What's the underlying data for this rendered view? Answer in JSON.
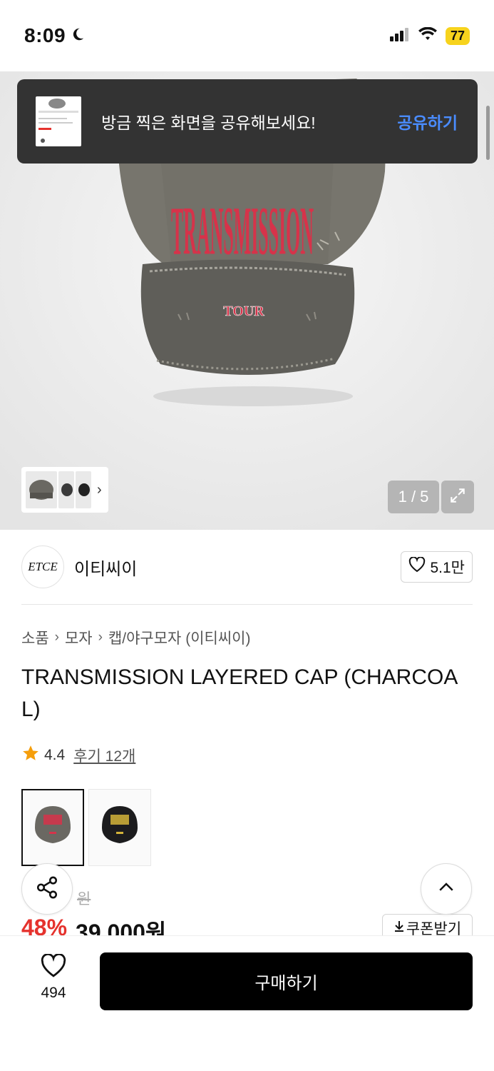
{
  "status_bar": {
    "time": "8:09",
    "battery": "77"
  },
  "share_toast": {
    "message": "방금 찍은 화면을 공유해보세요!",
    "action_label": "공유하기"
  },
  "hero": {
    "cap_text_main": "TRANSMISSION",
    "cap_text_sub": "TOUR",
    "page_indicator": "1 / 5"
  },
  "brand": {
    "logo_text": "ETCE",
    "name": "이티씨이",
    "likes": "5.1만"
  },
  "breadcrumb": {
    "items": [
      "소품",
      "모자",
      "캡/야구모자 (이티씨이)"
    ]
  },
  "product": {
    "title": "TRANSMISSION LAYERED CAP (CHARCOAL)",
    "rating": "4.4",
    "reviews_label": "후기 12개",
    "original_price": "원",
    "discount": "48%",
    "price": "39,000원"
  },
  "coupon_label": "쿠폰받기",
  "bottom": {
    "wish_count": "494",
    "buy_label": "구매하기"
  },
  "colors": {
    "star": "#f59e0b",
    "discount": "#e5322d",
    "toast_action": "#4a8cff"
  }
}
